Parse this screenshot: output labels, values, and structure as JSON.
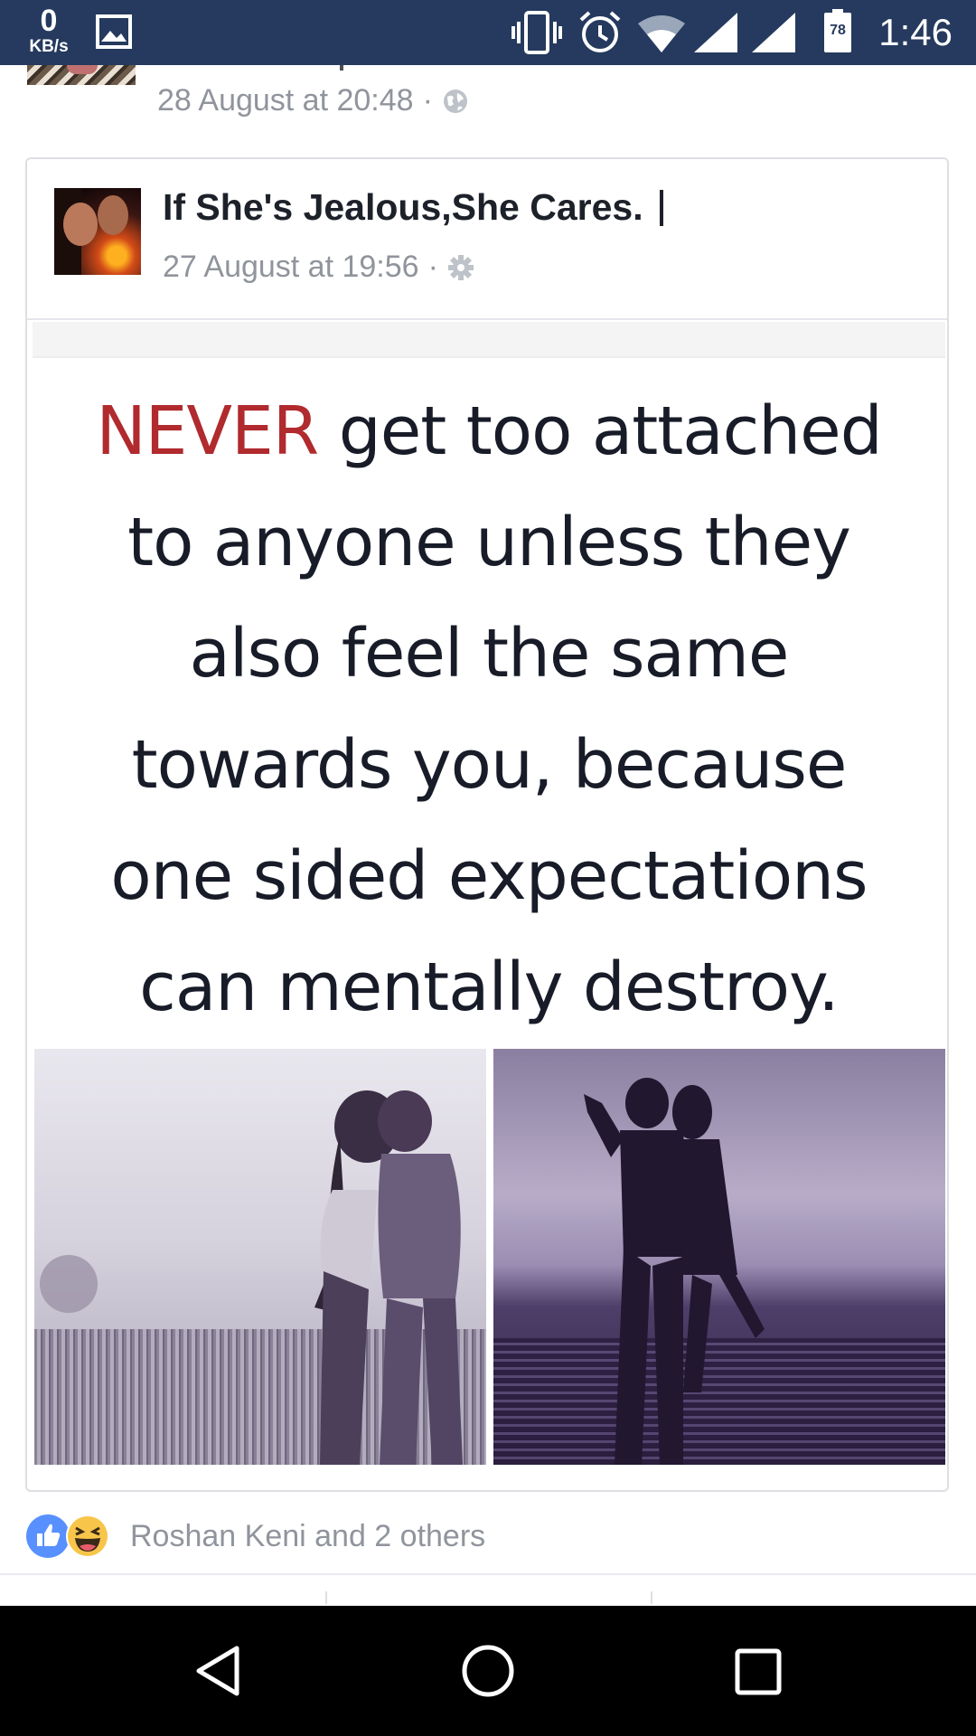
{
  "status_bar": {
    "net_speed_value": "0",
    "net_speed_unit": "KB/s",
    "battery_level": "78",
    "time": "1:46",
    "icons": [
      "gallery-icon",
      "vibrate-icon",
      "alarm-icon",
      "wifi-icon",
      "signal-icon",
      "signal-icon",
      "battery-icon"
    ]
  },
  "previous_post": {
    "timestamp": "28 August at 20:48",
    "separator": "·",
    "privacy_icon": "globe-icon"
  },
  "shared_post": {
    "page_name": "If She's Jealous,She Cares.",
    "timestamp": "27 August at 19:56",
    "separator": "·",
    "privacy_icon": "gear-icon",
    "image": {
      "quote_emphasis": "NEVER",
      "quote_line1_rest": " get too attached",
      "quote_line2": "to anyone unless they",
      "quote_line3": "also feel the same",
      "quote_line4": "towards you, because",
      "quote_line5": "one sided expectations",
      "quote_line6": "can mentally destroy."
    }
  },
  "reactions": {
    "icons": [
      "like-icon",
      "haha-icon"
    ],
    "text": "Roshan Keni and 2 others"
  },
  "colors": {
    "status_bar": "#253a5e",
    "nav_bar": "#000000",
    "meta_gray": "#90949c",
    "like_blue": "#5890ff",
    "never_red": "#b02a2e"
  }
}
